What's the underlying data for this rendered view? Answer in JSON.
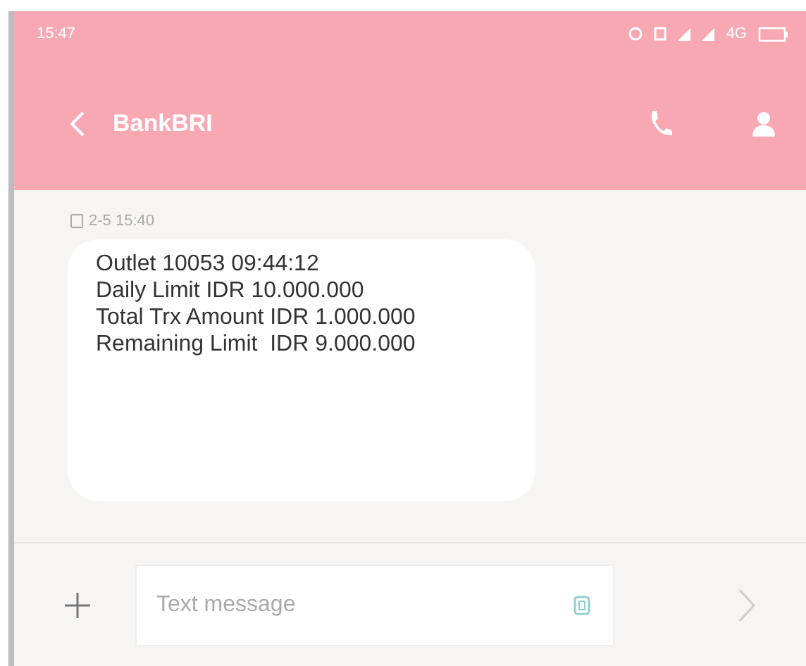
{
  "status_bar": {
    "time": "15:47",
    "network": "4G"
  },
  "toolbar": {
    "title": "BankBRI"
  },
  "messages": [
    {
      "timestamp": "2-5 15:40",
      "lines": [
        "Outlet 10053 09:44:12",
        "Daily Limit IDR 10.000.000",
        "Total Trx Amount IDR 1.000.000",
        "Remaining Limit  IDR 9.000.000"
      ]
    }
  ],
  "composer": {
    "placeholder": "Text message"
  }
}
